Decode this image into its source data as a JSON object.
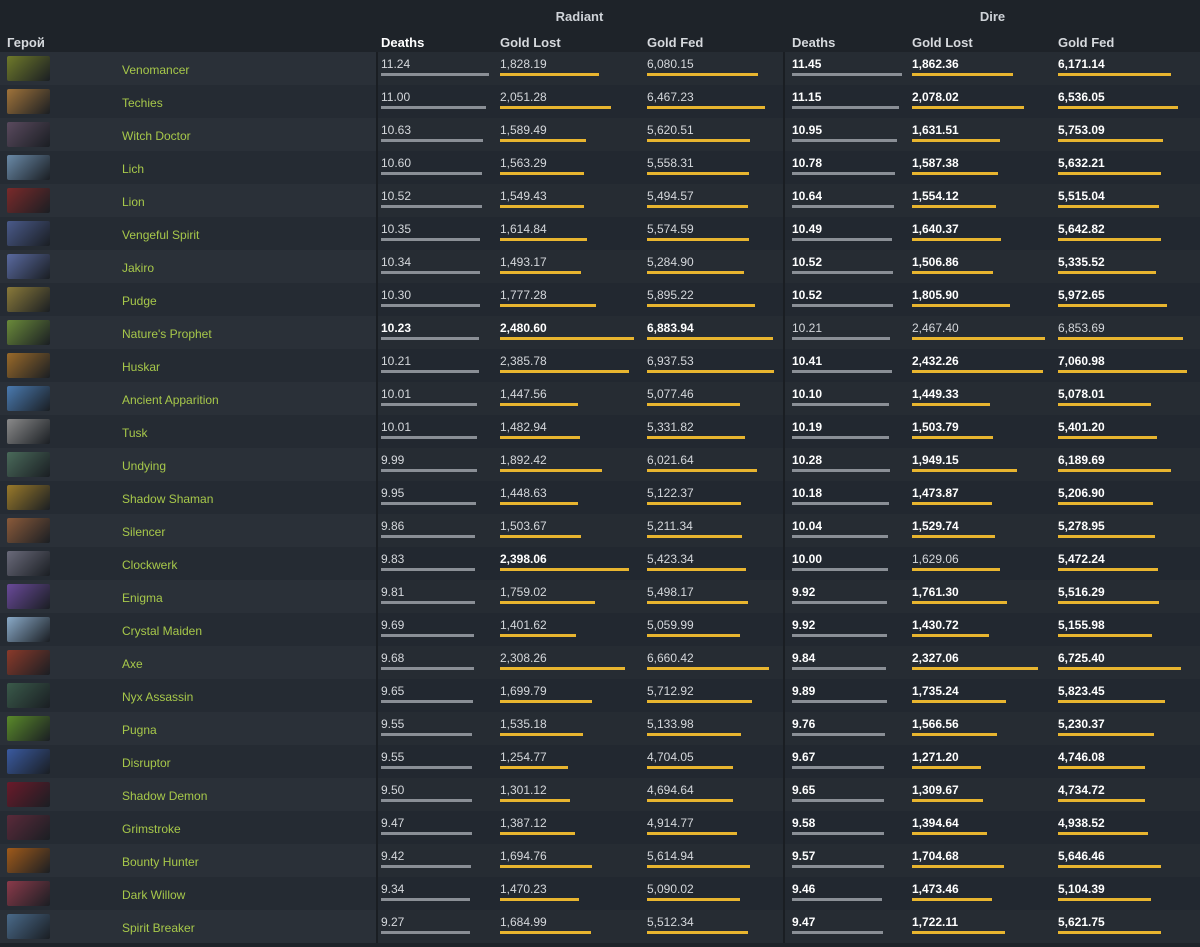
{
  "groups": {
    "radiant": "Radiant",
    "dire": "Dire"
  },
  "columns": {
    "hero": "Герой",
    "rad_deaths": "Deaths",
    "rad_gold_lost": "Gold Lost",
    "rad_gold_fed": "Gold Fed",
    "dire_deaths": "Deaths",
    "dire_gold_lost": "Gold Lost",
    "dire_gold_fed": "Gold Fed"
  },
  "colors": {
    "hero_name": "#a7c84a",
    "bar_gold": "#e8b52f",
    "bar_gray": "#8a8f96",
    "background": "#1e2329"
  },
  "rows": [
    {
      "hero": "Venomancer",
      "icon": "venomancer-portrait",
      "color": "#6f7a2a",
      "r": [
        "11.24",
        "1,828.19",
        "6,080.15"
      ],
      "d": [
        "11.45",
        "1,862.36",
        "6,171.14"
      ],
      "rb": [
        0,
        0,
        0
      ],
      "db": [
        1,
        1,
        1
      ],
      "rv": [
        11.24,
        1828.19,
        6080.15
      ],
      "dv": [
        11.45,
        1862.36,
        6171.14
      ]
    },
    {
      "hero": "Techies",
      "icon": "techies-portrait",
      "color": "#a0733a",
      "r": [
        "11.00",
        "2,051.28",
        "6,467.23"
      ],
      "d": [
        "11.15",
        "2,078.02",
        "6,536.05"
      ],
      "rb": [
        0,
        0,
        0
      ],
      "db": [
        1,
        1,
        1
      ],
      "rv": [
        11.0,
        2051.28,
        6467.23
      ],
      "dv": [
        11.15,
        2078.02,
        6536.05
      ]
    },
    {
      "hero": "Witch Doctor",
      "icon": "witch-doctor-portrait",
      "color": "#5a4a5e",
      "r": [
        "10.63",
        "1,589.49",
        "5,620.51"
      ],
      "d": [
        "10.95",
        "1,631.51",
        "5,753.09"
      ],
      "rb": [
        0,
        0,
        0
      ],
      "db": [
        1,
        1,
        1
      ],
      "rv": [
        10.63,
        1589.49,
        5620.51
      ],
      "dv": [
        10.95,
        1631.51,
        5753.09
      ]
    },
    {
      "hero": "Lich",
      "icon": "lich-portrait",
      "color": "#6a8aa8",
      "r": [
        "10.60",
        "1,563.29",
        "5,558.31"
      ],
      "d": [
        "10.78",
        "1,587.38",
        "5,632.21"
      ],
      "rb": [
        0,
        0,
        0
      ],
      "db": [
        1,
        1,
        1
      ],
      "rv": [
        10.6,
        1563.29,
        5558.31
      ],
      "dv": [
        10.78,
        1587.38,
        5632.21
      ]
    },
    {
      "hero": "Lion",
      "icon": "lion-portrait",
      "color": "#7a2a2a",
      "r": [
        "10.52",
        "1,549.43",
        "5,494.57"
      ],
      "d": [
        "10.64",
        "1,554.12",
        "5,515.04"
      ],
      "rb": [
        0,
        0,
        0
      ],
      "db": [
        1,
        1,
        1
      ],
      "rv": [
        10.52,
        1549.43,
        5494.57
      ],
      "dv": [
        10.64,
        1554.12,
        5515.04
      ]
    },
    {
      "hero": "Vengeful Spirit",
      "icon": "vengeful-spirit-portrait",
      "color": "#4a5a8a",
      "r": [
        "10.35",
        "1,614.84",
        "5,574.59"
      ],
      "d": [
        "10.49",
        "1,640.37",
        "5,642.82"
      ],
      "rb": [
        0,
        0,
        0
      ],
      "db": [
        1,
        1,
        1
      ],
      "rv": [
        10.35,
        1614.84,
        5574.59
      ],
      "dv": [
        10.49,
        1640.37,
        5642.82
      ]
    },
    {
      "hero": "Jakiro",
      "icon": "jakiro-portrait",
      "color": "#5a6aa0",
      "r": [
        "10.34",
        "1,493.17",
        "5,284.90"
      ],
      "d": [
        "10.52",
        "1,506.86",
        "5,335.52"
      ],
      "rb": [
        0,
        0,
        0
      ],
      "db": [
        1,
        1,
        1
      ],
      "rv": [
        10.34,
        1493.17,
        5284.9
      ],
      "dv": [
        10.52,
        1506.86,
        5335.52
      ]
    },
    {
      "hero": "Pudge",
      "icon": "pudge-portrait",
      "color": "#8a7a3a",
      "r": [
        "10.30",
        "1,777.28",
        "5,895.22"
      ],
      "d": [
        "10.52",
        "1,805.90",
        "5,972.65"
      ],
      "rb": [
        0,
        0,
        0
      ],
      "db": [
        1,
        1,
        1
      ],
      "rv": [
        10.3,
        1777.28,
        5895.22
      ],
      "dv": [
        10.52,
        1805.9,
        5972.65
      ]
    },
    {
      "hero": "Nature's Prophet",
      "icon": "natures-prophet-portrait",
      "color": "#6a8a3a",
      "r": [
        "10.23",
        "2,480.60",
        "6,883.94"
      ],
      "d": [
        "10.21",
        "2,467.40",
        "6,853.69"
      ],
      "rb": [
        1,
        1,
        1
      ],
      "db": [
        0,
        0,
        0
      ],
      "rv": [
        10.23,
        2480.6,
        6883.94
      ],
      "dv": [
        10.21,
        2467.4,
        6853.69
      ]
    },
    {
      "hero": "Huskar",
      "icon": "huskar-portrait",
      "color": "#9a6a2a",
      "r": [
        "10.21",
        "2,385.78",
        "6,937.53"
      ],
      "d": [
        "10.41",
        "2,432.26",
        "7,060.98"
      ],
      "rb": [
        0,
        0,
        0
      ],
      "db": [
        1,
        1,
        1
      ],
      "rv": [
        10.21,
        2385.78,
        6937.53
      ],
      "dv": [
        10.41,
        2432.26,
        7060.98
      ]
    },
    {
      "hero": "Ancient Apparition",
      "icon": "ancient-apparition-portrait",
      "color": "#4a7ab0",
      "r": [
        "10.01",
        "1,447.56",
        "5,077.46"
      ],
      "d": [
        "10.10",
        "1,449.33",
        "5,078.01"
      ],
      "rb": [
        0,
        0,
        0
      ],
      "db": [
        1,
        1,
        1
      ],
      "rv": [
        10.01,
        1447.56,
        5077.46
      ],
      "dv": [
        10.1,
        1449.33,
        5078.01
      ]
    },
    {
      "hero": "Tusk",
      "icon": "tusk-portrait",
      "color": "#8a8a8a",
      "r": [
        "10.01",
        "1,482.94",
        "5,331.82"
      ],
      "d": [
        "10.19",
        "1,503.79",
        "5,401.20"
      ],
      "rb": [
        0,
        0,
        0
      ],
      "db": [
        1,
        1,
        1
      ],
      "rv": [
        10.01,
        1482.94,
        5331.82
      ],
      "dv": [
        10.19,
        1503.79,
        5401.2
      ]
    },
    {
      "hero": "Undying",
      "icon": "undying-portrait",
      "color": "#4a6a5a",
      "r": [
        "9.99",
        "1,892.42",
        "6,021.64"
      ],
      "d": [
        "10.28",
        "1,949.15",
        "6,189.69"
      ],
      "rb": [
        0,
        0,
        0
      ],
      "db": [
        1,
        1,
        1
      ],
      "rv": [
        9.99,
        1892.42,
        6021.64
      ],
      "dv": [
        10.28,
        1949.15,
        6189.69
      ]
    },
    {
      "hero": "Shadow Shaman",
      "icon": "shadow-shaman-portrait",
      "color": "#9a7a2a",
      "r": [
        "9.95",
        "1,448.63",
        "5,122.37"
      ],
      "d": [
        "10.18",
        "1,473.87",
        "5,206.90"
      ],
      "rb": [
        0,
        0,
        0
      ],
      "db": [
        1,
        1,
        1
      ],
      "rv": [
        9.95,
        1448.63,
        5122.37
      ],
      "dv": [
        10.18,
        1473.87,
        5206.9
      ]
    },
    {
      "hero": "Silencer",
      "icon": "silencer-portrait",
      "color": "#8a5a3a",
      "r": [
        "9.86",
        "1,503.67",
        "5,211.34"
      ],
      "d": [
        "10.04",
        "1,529.74",
        "5,278.95"
      ],
      "rb": [
        0,
        0,
        0
      ],
      "db": [
        1,
        1,
        1
      ],
      "rv": [
        9.86,
        1503.67,
        5211.34
      ],
      "dv": [
        10.04,
        1529.74,
        5278.95
      ]
    },
    {
      "hero": "Clockwerk",
      "icon": "clockwerk-portrait",
      "color": "#6a6a7a",
      "r": [
        "9.83",
        "2,398.06",
        "5,423.34"
      ],
      "d": [
        "10.00",
        "1,629.06",
        "5,472.24"
      ],
      "rb": [
        0,
        1,
        0
      ],
      "db": [
        1,
        0,
        1
      ],
      "rv": [
        9.83,
        2398.06,
        5423.34
      ],
      "dv": [
        10.0,
        1629.06,
        5472.24
      ]
    },
    {
      "hero": "Enigma",
      "icon": "enigma-portrait",
      "color": "#6a4a9a",
      "r": [
        "9.81",
        "1,759.02",
        "5,498.17"
      ],
      "d": [
        "9.92",
        "1,761.30",
        "5,516.29"
      ],
      "rb": [
        0,
        0,
        0
      ],
      "db": [
        1,
        1,
        1
      ],
      "rv": [
        9.81,
        1759.02,
        5498.17
      ],
      "dv": [
        9.92,
        1761.3,
        5516.29
      ]
    },
    {
      "hero": "Crystal Maiden",
      "icon": "crystal-maiden-portrait",
      "color": "#8aaac8",
      "r": [
        "9.69",
        "1,401.62",
        "5,059.99"
      ],
      "d": [
        "9.92",
        "1,430.72",
        "5,155.98"
      ],
      "rb": [
        0,
        0,
        0
      ],
      "db": [
        1,
        1,
        1
      ],
      "rv": [
        9.69,
        1401.62,
        5059.99
      ],
      "dv": [
        9.92,
        1430.72,
        5155.98
      ]
    },
    {
      "hero": "Axe",
      "icon": "axe-portrait",
      "color": "#8a3a2a",
      "r": [
        "9.68",
        "2,308.26",
        "6,660.42"
      ],
      "d": [
        "9.84",
        "2,327.06",
        "6,725.40"
      ],
      "rb": [
        0,
        0,
        0
      ],
      "db": [
        1,
        1,
        1
      ],
      "rv": [
        9.68,
        2308.26,
        6660.42
      ],
      "dv": [
        9.84,
        2327.06,
        6725.4
      ]
    },
    {
      "hero": "Nyx Assassin",
      "icon": "nyx-assassin-portrait",
      "color": "#3a5a4a",
      "r": [
        "9.65",
        "1,699.79",
        "5,712.92"
      ],
      "d": [
        "9.89",
        "1,735.24",
        "5,823.45"
      ],
      "rb": [
        0,
        0,
        0
      ],
      "db": [
        1,
        1,
        1
      ],
      "rv": [
        9.65,
        1699.79,
        5712.92
      ],
      "dv": [
        9.89,
        1735.24,
        5823.45
      ]
    },
    {
      "hero": "Pugna",
      "icon": "pugna-portrait",
      "color": "#5a8a2a",
      "r": [
        "9.55",
        "1,535.18",
        "5,133.98"
      ],
      "d": [
        "9.76",
        "1,566.56",
        "5,230.37"
      ],
      "rb": [
        0,
        0,
        0
      ],
      "db": [
        1,
        1,
        1
      ],
      "rv": [
        9.55,
        1535.18,
        5133.98
      ],
      "dv": [
        9.76,
        1566.56,
        5230.37
      ]
    },
    {
      "hero": "Disruptor",
      "icon": "disruptor-portrait",
      "color": "#3a5aa0",
      "r": [
        "9.55",
        "1,254.77",
        "4,704.05"
      ],
      "d": [
        "9.67",
        "1,271.20",
        "4,746.08"
      ],
      "rb": [
        0,
        0,
        0
      ],
      "db": [
        1,
        1,
        1
      ],
      "rv": [
        9.55,
        1254.77,
        4704.05
      ],
      "dv": [
        9.67,
        1271.2,
        4746.08
      ]
    },
    {
      "hero": "Shadow Demon",
      "icon": "shadow-demon-portrait",
      "color": "#6a1a2a",
      "r": [
        "9.50",
        "1,301.12",
        "4,694.64"
      ],
      "d": [
        "9.65",
        "1,309.67",
        "4,734.72"
      ],
      "rb": [
        0,
        0,
        0
      ],
      "db": [
        1,
        1,
        1
      ],
      "rv": [
        9.5,
        1301.12,
        4694.64
      ],
      "dv": [
        9.65,
        1309.67,
        4734.72
      ]
    },
    {
      "hero": "Grimstroke",
      "icon": "grimstroke-portrait",
      "color": "#5a2a3a",
      "r": [
        "9.47",
        "1,387.12",
        "4,914.77"
      ],
      "d": [
        "9.58",
        "1,394.64",
        "4,938.52"
      ],
      "rb": [
        0,
        0,
        0
      ],
      "db": [
        1,
        1,
        1
      ],
      "rv": [
        9.47,
        1387.12,
        4914.77
      ],
      "dv": [
        9.58,
        1394.64,
        4938.52
      ]
    },
    {
      "hero": "Bounty Hunter",
      "icon": "bounty-hunter-portrait",
      "color": "#a05a1a",
      "r": [
        "9.42",
        "1,694.76",
        "5,614.94"
      ],
      "d": [
        "9.57",
        "1,704.68",
        "5,646.46"
      ],
      "rb": [
        0,
        0,
        0
      ],
      "db": [
        1,
        1,
        1
      ],
      "rv": [
        9.42,
        1694.76,
        5614.94
      ],
      "dv": [
        9.57,
        1704.68,
        5646.46
      ]
    },
    {
      "hero": "Dark Willow",
      "icon": "dark-willow-portrait",
      "color": "#8a3a4a",
      "r": [
        "9.34",
        "1,470.23",
        "5,090.02"
      ],
      "d": [
        "9.46",
        "1,473.46",
        "5,104.39"
      ],
      "rb": [
        0,
        0,
        0
      ],
      "db": [
        1,
        1,
        1
      ],
      "rv": [
        9.34,
        1470.23,
        5090.02
      ],
      "dv": [
        9.46,
        1473.46,
        5104.39
      ]
    },
    {
      "hero": "Spirit Breaker",
      "icon": "spirit-breaker-portrait",
      "color": "#4a6a8a",
      "r": [
        "9.27",
        "1,684.99",
        "5,512.34"
      ],
      "d": [
        "9.47",
        "1,722.11",
        "5,621.75"
      ],
      "rb": [
        0,
        0,
        0
      ],
      "db": [
        1,
        1,
        1
      ],
      "rv": [
        9.27,
        1684.99,
        5512.34
      ],
      "dv": [
        9.47,
        1722.11,
        5621.75
      ]
    }
  ]
}
